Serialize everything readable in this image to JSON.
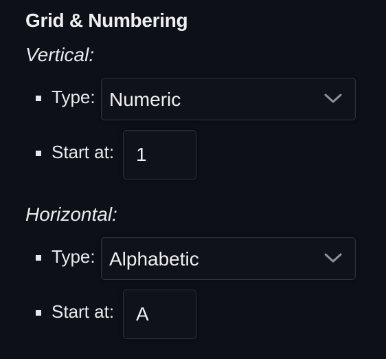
{
  "panel": {
    "title": "Grid & Numbering"
  },
  "vertical": {
    "heading": "Vertical:",
    "type_label": "Type:",
    "type_value": "Numeric",
    "start_label": "Start at:",
    "start_value": "1"
  },
  "horizontal": {
    "heading": "Horizontal:",
    "type_label": "Type:",
    "type_value": "Alphabetic",
    "start_label": "Start at:",
    "start_value": "A"
  },
  "icons": {
    "dropdown": "chevron-down-icon"
  }
}
